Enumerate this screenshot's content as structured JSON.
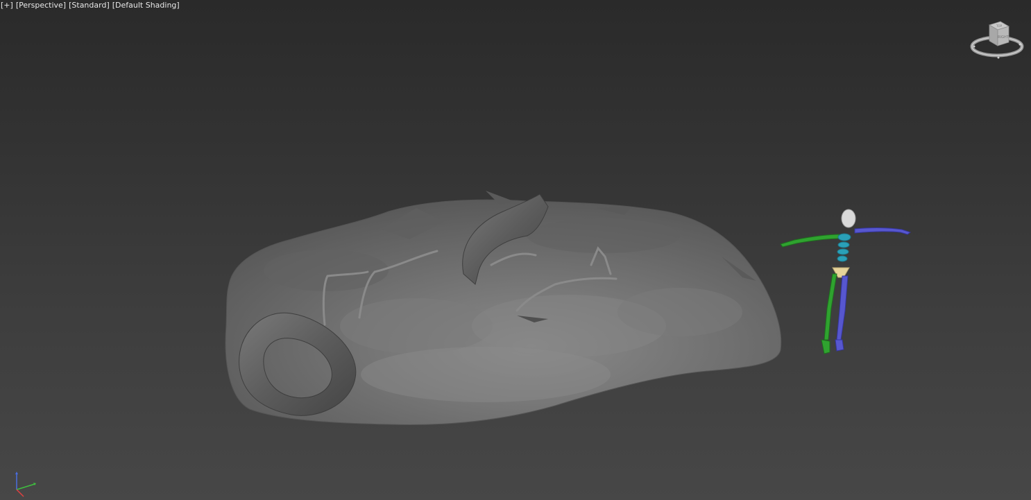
{
  "viewport": {
    "menu": {
      "plus_label": "[+]",
      "view_label": "[Perspective]",
      "camera_label": "[Standard]",
      "shading_label": "[Default Shading]"
    },
    "viewcube": {
      "top_face_label": "TOP",
      "front_face_label": "RIGHT"
    },
    "colors": {
      "background_top": "#2a2a2a",
      "background_bottom": "#474747",
      "terrain": "#6e6e6e",
      "biped_left": "#2fa32f",
      "biped_right": "#5757cf",
      "biped_spine": "#2aa0b8",
      "biped_pelvis": "#e6d39a",
      "biped_head": "#d9d9d9"
    },
    "icons": {
      "viewcube": "viewcube-icon",
      "axis_tripod": "axis-tripod-icon"
    }
  }
}
